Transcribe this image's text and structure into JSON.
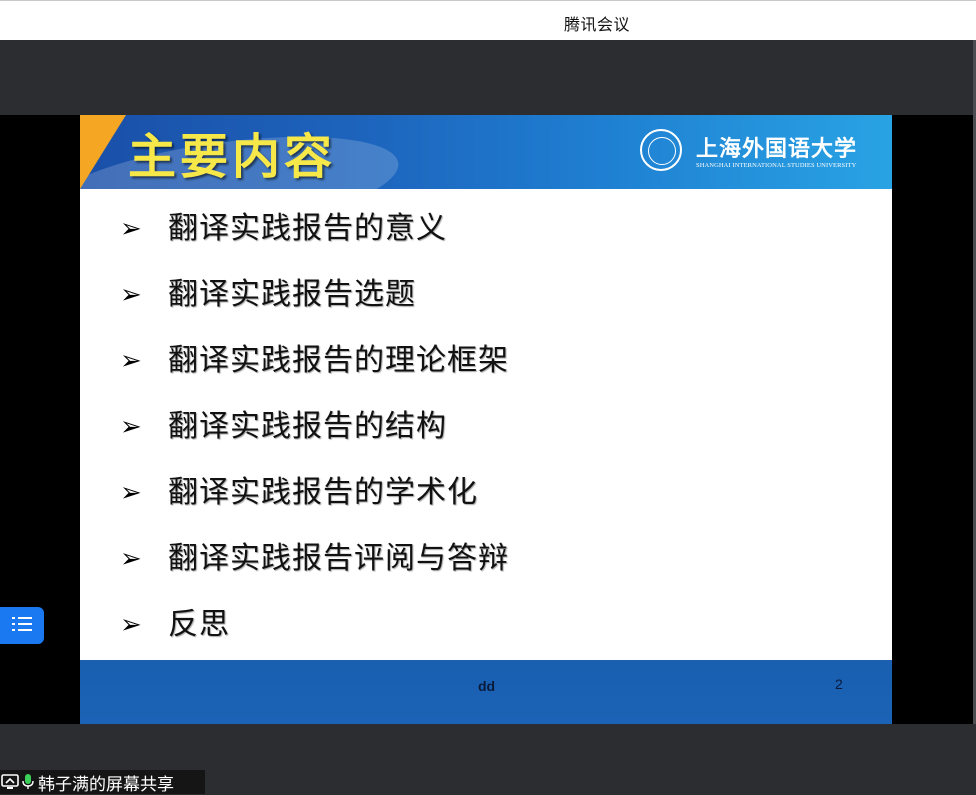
{
  "window": {
    "title": "腾讯会议"
  },
  "slide": {
    "title": "主要内容",
    "logo": {
      "name": "上海外国语大学",
      "subtitle": "SHANGHAI INTERNATIONAL STUDIES UNIVERSITY",
      "seal_year": "1949"
    },
    "bullet_glyph": "➢",
    "items": [
      "翻译实践报告的意义",
      "翻译实践报告选题",
      "翻译实践报告的理论框架",
      "翻译实践报告的结构",
      "翻译实践报告的学术化",
      "翻译实践报告评阅与答辩",
      "反思"
    ],
    "footer_text": "dd",
    "page_number": "2"
  },
  "toc_button": {
    "icon": "list-icon"
  },
  "share_label": {
    "icons": [
      "screen-share-icon",
      "microphone-icon"
    ],
    "text": "韩子满的屏幕共享"
  },
  "colors": {
    "accent_blue": "#1a78f0",
    "slide_header_blue": "#1d64bd",
    "slide_title_yellow": "#f7e84a",
    "orange_tab": "#f5a623"
  }
}
